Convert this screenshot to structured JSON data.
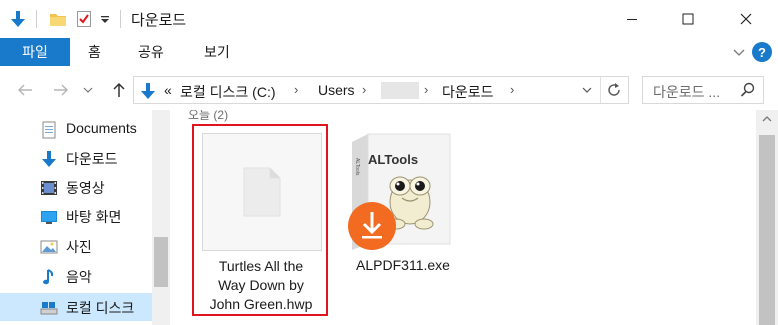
{
  "window": {
    "title": "다운로드",
    "quick_access_icons": [
      "down-arrow-icon",
      "folder-icon",
      "properties-icon",
      "customize-dropdown-icon"
    ],
    "controls": [
      "minimize-icon",
      "maximize-icon",
      "close-icon"
    ]
  },
  "ribbon": {
    "tabs": [
      {
        "label": "파일",
        "active": true
      },
      {
        "label": "홈"
      },
      {
        "label": "공유"
      },
      {
        "label": "보기"
      }
    ],
    "help_label": "?"
  },
  "address": {
    "overflow": "«",
    "segments": [
      "로컬 디스크 (C:)",
      "Users",
      "다운로드"
    ],
    "search_placeholder": "다운로드 ..."
  },
  "nav_pane": {
    "items": [
      {
        "label": "Documents",
        "icon": "documents-icon"
      },
      {
        "label": "다운로드",
        "icon": "download-icon"
      },
      {
        "label": "동영상",
        "icon": "video-icon"
      },
      {
        "label": "바탕 화면",
        "icon": "desktop-icon"
      },
      {
        "label": "사진",
        "icon": "pictures-icon"
      },
      {
        "label": "음악",
        "icon": "music-icon"
      },
      {
        "label": "로컬 디스크",
        "icon": "local-disk-icon",
        "selected": true
      }
    ]
  },
  "content": {
    "group_header": "오늘 (2)",
    "files": [
      {
        "name_lines": [
          "Turtles All the",
          "Way Down by",
          "John Green.hwp"
        ],
        "type": "document",
        "highlighted": true
      },
      {
        "name_lines": [
          "ALPDF311.exe"
        ],
        "type": "installer",
        "box_brand": "ALTools",
        "box_side": "ALTools"
      }
    ]
  },
  "colors": {
    "accent": "#1979ca",
    "highlight_border": "#e0141e",
    "nav_selected": "#cce8ff",
    "download_badge": "#f26b21"
  }
}
